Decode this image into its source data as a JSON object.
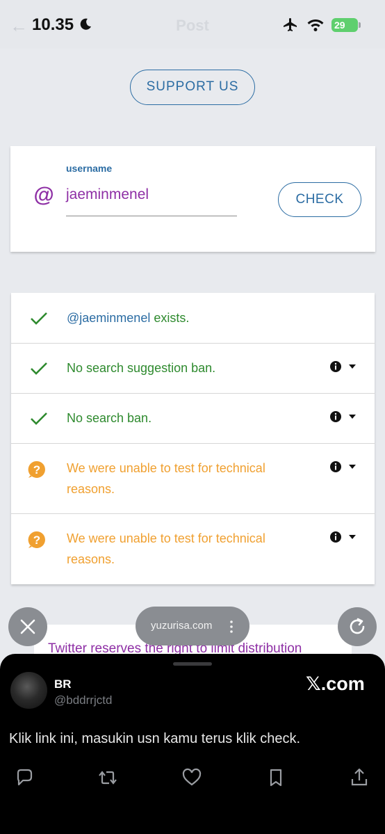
{
  "status_bar": {
    "time": "10.35",
    "battery": "29",
    "back_hint": "←",
    "title_hint": "Post"
  },
  "support": {
    "label": "SUPPORT US"
  },
  "username_form": {
    "prefix": "@",
    "label": "username",
    "value": "jaeminmenel",
    "check_label": "CHECK"
  },
  "results": [
    {
      "handle": "@jaeminmenel",
      "text": " exists."
    },
    {
      "text": "No search suggestion ban."
    },
    {
      "text": "No search ban."
    },
    {
      "text": "We were unable to test for technical reasons."
    },
    {
      "text": "We were unable to test for technical reasons."
    }
  ],
  "hidden_card": {
    "text": "Twitter reserves the right to limit distribution"
  },
  "browser": {
    "url": "yuzurisa.com"
  },
  "post": {
    "author_name": "BR",
    "author_handle": "@bddrrjctd",
    "brand": "𝕏.com",
    "text": "Klik link ini, masukin usn kamu terus klik check."
  },
  "colors": {
    "accent_blue": "#2b6ca3",
    "purple": "#8e2fa5",
    "success_green": "#2e8a2e",
    "warning_orange": "#f0a030"
  },
  "icons": [
    "moon-icon",
    "airplane-icon",
    "wifi-icon",
    "check-icon",
    "question-icon",
    "info-icon",
    "caret-down-icon",
    "close-icon",
    "reload-icon",
    "more-icon",
    "reply-icon",
    "repost-icon",
    "like-icon",
    "bookmark-icon",
    "share-icon"
  ]
}
